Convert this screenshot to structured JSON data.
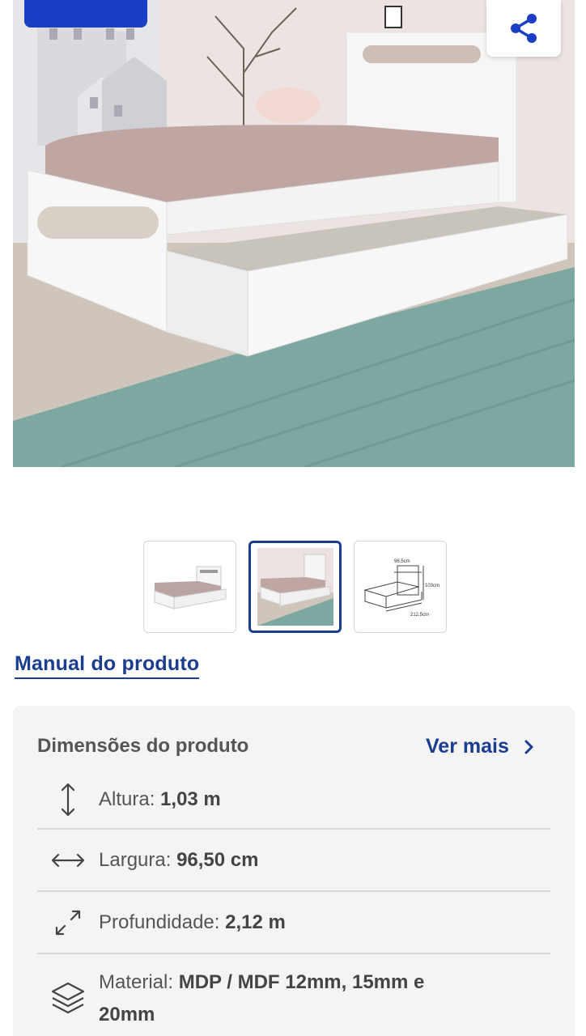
{
  "hero": {
    "image_alt": "Bicama branca com cama auxiliar",
    "share_icon": "share-icon"
  },
  "thumbnails": [
    {
      "name": "thumb-bed-front",
      "active": false
    },
    {
      "name": "thumb-bed-room",
      "active": true
    },
    {
      "name": "thumb-bed-dimensions",
      "active": false,
      "labels": {
        "width": "96,5cm",
        "height": "103cm",
        "depth": "212,5cm"
      }
    }
  ],
  "manual_link": "Manual do produto",
  "dimensions": {
    "title": "Dimensões do produto",
    "ver_mais": "Ver mais",
    "rows": [
      {
        "label": "Altura:",
        "value": "1,03 m",
        "icon": "vertical-arrows-icon"
      },
      {
        "label": "Largura:",
        "value": "96,50 cm",
        "icon": "horizontal-arrows-icon"
      },
      {
        "label": "Profundidade:",
        "value": "2,12 m",
        "icon": "diagonal-arrows-icon"
      },
      {
        "label": "Material:",
        "value": "MDP / MDF 12mm, 15mm e",
        "value2": "20mm",
        "icon": "layers-icon"
      }
    ]
  },
  "colors": {
    "accent": "#1b3d8f",
    "badge": "#1a3fc4",
    "card_bg": "#f4f4f4"
  }
}
